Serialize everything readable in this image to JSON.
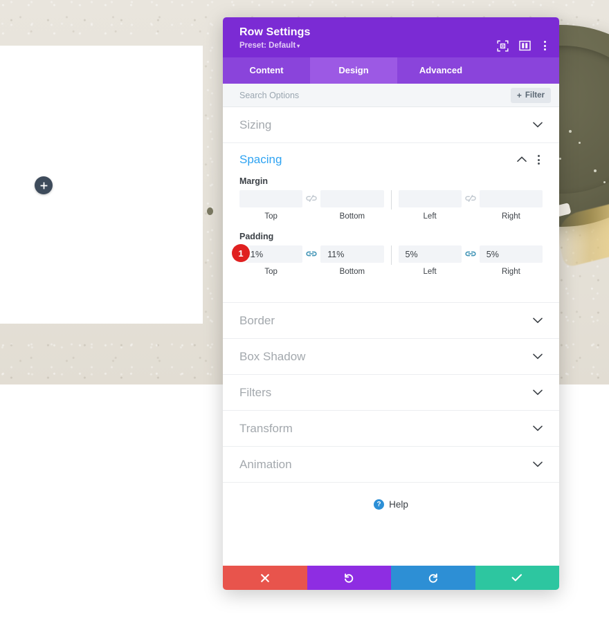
{
  "canvas": {
    "add_button_label": "+",
    "add_button_name": "add-module-button"
  },
  "modal": {
    "title": "Row Settings",
    "preset_label": "Preset: Default",
    "preset_caret": "▾",
    "header_icons": [
      {
        "name": "fullscreen-icon",
        "label": "fullscreen"
      },
      {
        "name": "panel-layout-icon",
        "label": "layout"
      },
      {
        "name": "kebab-menu-icon",
        "label": "more"
      }
    ],
    "tabs": [
      {
        "label": "Content",
        "active": false
      },
      {
        "label": "Design",
        "active": true
      },
      {
        "label": "Advanced",
        "active": false
      }
    ],
    "search": {
      "placeholder": "Search Options",
      "value": ""
    },
    "filter_button": {
      "plus": "+",
      "label": "Filter"
    },
    "sections": [
      {
        "label": "Sizing",
        "state": "collapsed"
      },
      {
        "label": "Spacing",
        "state": "expanded"
      },
      {
        "label": "Border",
        "state": "collapsed"
      },
      {
        "label": "Box Shadow",
        "state": "collapsed"
      },
      {
        "label": "Filters",
        "state": "collapsed"
      },
      {
        "label": "Transform",
        "state": "collapsed"
      },
      {
        "label": "Animation",
        "state": "collapsed"
      }
    ],
    "spacing": {
      "title": "Spacing",
      "margin": {
        "label": "Margin",
        "top": {
          "value": "",
          "placeholder": "",
          "caption": "Top"
        },
        "bottom": {
          "value": "",
          "placeholder": "",
          "caption": "Bottom"
        },
        "left": {
          "value": "",
          "placeholder": "",
          "caption": "Left"
        },
        "right": {
          "value": "",
          "placeholder": "",
          "caption": "Right"
        },
        "link_state_vertical": "unlinked",
        "link_state_horizontal": "unlinked"
      },
      "padding": {
        "label": "Padding",
        "top": {
          "value": "11%",
          "caption": "Top"
        },
        "bottom": {
          "value": "11%",
          "caption": "Bottom"
        },
        "left": {
          "value": "5%",
          "caption": "Left"
        },
        "right": {
          "value": "5%",
          "caption": "Right"
        },
        "link_state_vertical": "linked",
        "link_state_horizontal": "linked",
        "badge": "1"
      }
    },
    "help": {
      "icon_glyph": "?",
      "label": "Help"
    },
    "footer_buttons": [
      {
        "name": "cancel-button",
        "glyph": "✖",
        "color": "#e8544c"
      },
      {
        "name": "undo-button",
        "glyph": "↺",
        "color": "#8e2de2"
      },
      {
        "name": "redo-button",
        "glyph": "↻",
        "color": "#2d8fd5"
      },
      {
        "name": "save-button",
        "glyph": "✔",
        "color": "#2dc6a0"
      }
    ]
  },
  "colors": {
    "header_purple": "#7b2bd4",
    "tabbar_purple": "#8a44db",
    "tab_active_purple": "#9c59e4",
    "accent_blue": "#2ea3f2",
    "link_teal": "#3f93b5",
    "badge_red": "#e02020"
  }
}
